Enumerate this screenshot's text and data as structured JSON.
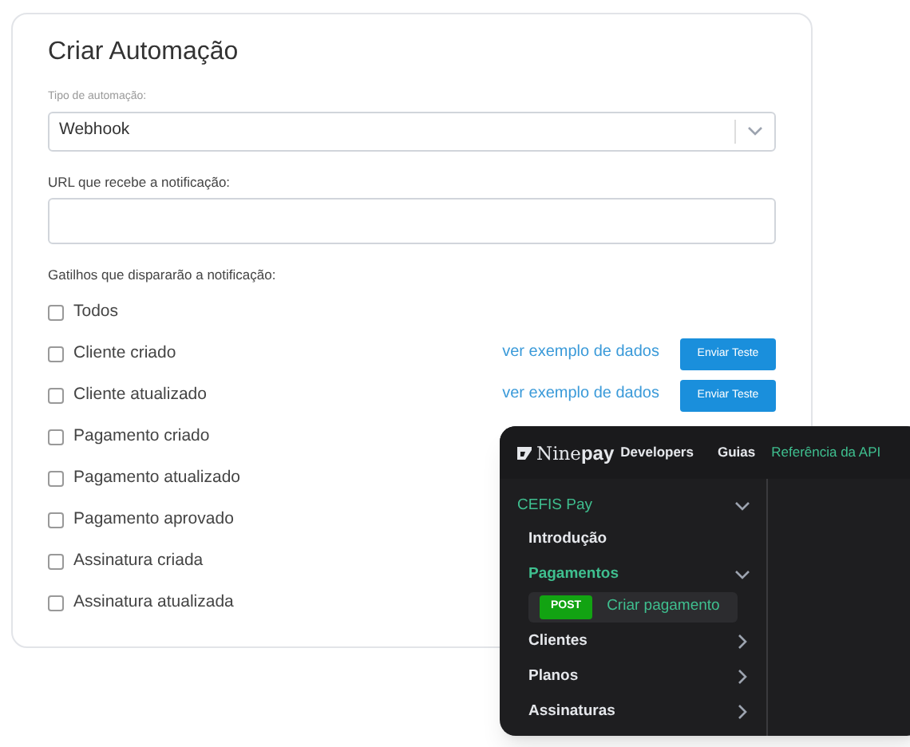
{
  "form": {
    "title": "Criar Automação",
    "type_field": {
      "label": "Tipo de automação:",
      "value": "Webhook"
    },
    "url_field": {
      "label": "URL que recebe a notificação:"
    },
    "triggers_label": "Gatilhos que dispararão a notificação:",
    "triggers": [
      {
        "label": "Todos",
        "checked": false
      },
      {
        "label": "Cliente criado",
        "checked": false,
        "link": "ver exemplo de dados",
        "button": "Enviar Teste"
      },
      {
        "label": "Cliente atualizado",
        "checked": false,
        "link": "ver exemplo de dados",
        "button": "Enviar Teste"
      },
      {
        "label": "Pagamento criado",
        "checked": false
      },
      {
        "label": "Pagamento atualizado",
        "checked": false
      },
      {
        "label": "Pagamento aprovado",
        "checked": false
      },
      {
        "label": "Assinatura criada",
        "checked": false
      },
      {
        "label": "Assinatura atualizada",
        "checked": false
      }
    ]
  },
  "docs": {
    "logo": {
      "light": "Nine",
      "bold": "pay",
      "suffix": "Developers"
    },
    "nav": [
      {
        "label": "Guias",
        "selected": false
      },
      {
        "label": "Referência da API",
        "selected": true
      }
    ],
    "sidebar": [
      {
        "label": "CEFIS Pay",
        "expanded": true,
        "children": [
          {
            "label": "Introdução",
            "selected": false
          },
          {
            "label": "Pagamentos",
            "expanded": true,
            "children": [
              {
                "label": "Criar pagamento",
                "method": "POST",
                "selected": true
              }
            ]
          },
          {
            "label": "Clientes",
            "expanded": false
          },
          {
            "label": "Planos",
            "expanded": false
          },
          {
            "label": "Assinaturas",
            "expanded": false
          }
        ]
      }
    ]
  }
}
